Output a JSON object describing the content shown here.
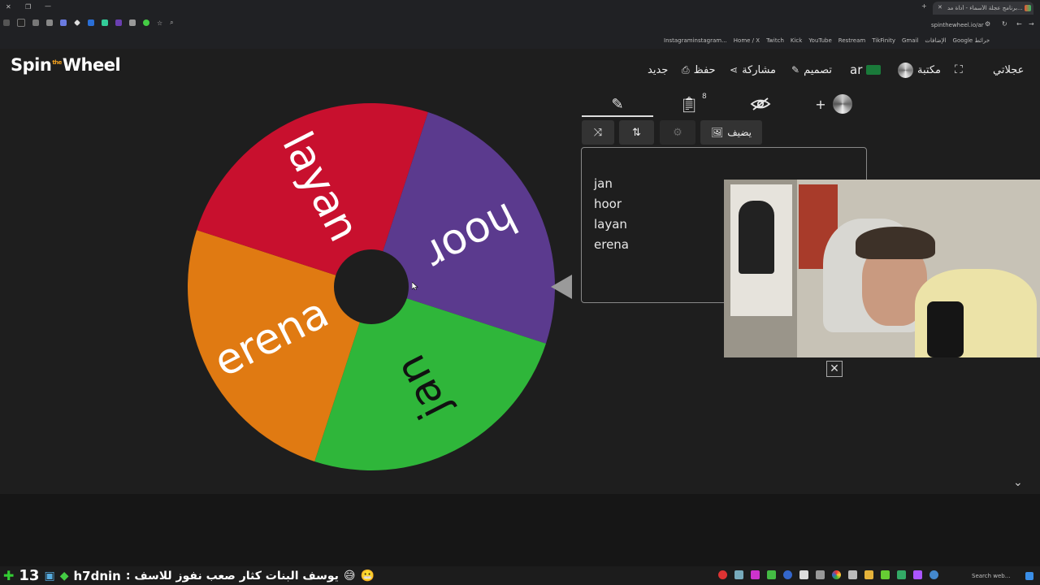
{
  "browser": {
    "tab_title": "برنامج عجلة الأسماء - أداة مد...",
    "url": "spinthewheel.io/ar",
    "bookmarks": [
      "Instagraminstagram...",
      "Home / X",
      "Twitch",
      "Kick",
      "YouTube",
      "Restream",
      "TikFinity",
      "Gmail",
      "الإضافات",
      "Google خرائط"
    ]
  },
  "app": {
    "logo_left": "Spin",
    "logo_mid": "the",
    "logo_right": "Wheel",
    "header": {
      "new": "جديد",
      "save": "حفظ",
      "share": "مشاركة",
      "design": "تصميم",
      "lang": "ar",
      "library": "مكتبة",
      "my_wheels": "عجلاتي"
    },
    "tabs": {
      "list_count": "8"
    },
    "toolbar": {
      "add_image": "يضيف"
    },
    "entries": [
      "jan",
      "hoor",
      "layan",
      "erena"
    ]
  },
  "wheel": {
    "segments": [
      {
        "label": "hoor",
        "color": "#5b3a8e"
      },
      {
        "label": "jan",
        "color": "#2fb63a"
      },
      {
        "label": "erena",
        "color": "#e07a12"
      },
      {
        "label": "layan",
        "color": "#c8102e"
      }
    ]
  },
  "overlay": {
    "chat_count": "13",
    "chat_user": "h7dnin",
    "chat_message": ": يوسف البنات كثار صعب نفوز للاسف"
  },
  "taskbar": {
    "search_placeholder": "Search web..."
  },
  "colors": {
    "background": "#1e1e1e",
    "accent": "#e8e8e8"
  }
}
